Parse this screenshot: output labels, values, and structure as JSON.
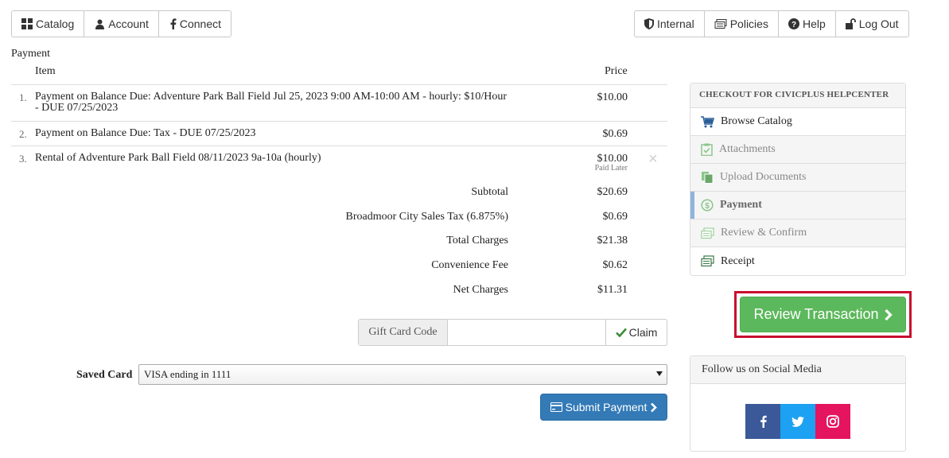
{
  "nav_left": [
    {
      "label": "Catalog",
      "icon": "grid-icon"
    },
    {
      "label": "Account",
      "icon": "user-icon"
    },
    {
      "label": "Connect",
      "icon": "facebook-icon"
    }
  ],
  "nav_right": [
    {
      "label": "Internal",
      "icon": "shield-icon"
    },
    {
      "label": "Policies",
      "icon": "money-icon"
    },
    {
      "label": "Help",
      "icon": "question-icon"
    },
    {
      "label": "Log Out",
      "icon": "unlock-icon"
    }
  ],
  "payment": {
    "section_label": "Payment",
    "col_item": "Item",
    "col_price": "Price",
    "rows": [
      {
        "num": "1.",
        "desc": "Payment on Balance Due: Adventure Park Ball Field Jul 25, 2023 9:00 AM-10:00 AM - hourly: $10/Hour - DUE 07/25/2023",
        "price": "$10.00"
      },
      {
        "num": "2.",
        "desc": "Payment on Balance Due: Tax - DUE 07/25/2023",
        "price": "$0.69"
      },
      {
        "num": "3.",
        "desc": "Rental of Adventure Park Ball Field 08/11/2023 9a-10a (hourly)",
        "price": "$10.00",
        "note": "Paid Later",
        "remove": "×"
      }
    ],
    "totals": [
      {
        "label": "Subtotal",
        "value": "$20.69"
      },
      {
        "label": "Broadmoor City Sales Tax (6.875%)",
        "value": "$0.69"
      },
      {
        "label": "Total Charges",
        "value": "$21.38"
      },
      {
        "label": "Convenience Fee",
        "value": "$0.62"
      },
      {
        "label": "Net Charges",
        "value": "$11.31"
      }
    ]
  },
  "gift_card": {
    "label": "Gift Card Code",
    "value": "",
    "claim_label": "Claim"
  },
  "saved_card": {
    "label": "Saved Card",
    "selected": "VISA ending in 1111"
  },
  "submit_label": "Submit Payment",
  "checkout": {
    "title": "CHECKOUT FOR CIVICPLUS HELPCENTER",
    "steps": [
      {
        "label": "Browse Catalog",
        "icon": "cart-icon",
        "state": "normal"
      },
      {
        "label": "Attachments",
        "icon": "clipboard-check-icon",
        "state": "dim"
      },
      {
        "label": "Upload Documents",
        "icon": "documents-icon",
        "state": "dim"
      },
      {
        "label": "Payment",
        "icon": "dollar-circle-icon",
        "state": "active"
      },
      {
        "label": "Review & Confirm",
        "icon": "money-icon",
        "state": "dim"
      },
      {
        "label": "Receipt",
        "icon": "money-icon",
        "state": "normal"
      }
    ]
  },
  "review_label": "Review Transaction",
  "social": {
    "title": "Follow us on Social Media",
    "links": [
      {
        "name": "facebook",
        "color": "#3b5998"
      },
      {
        "name": "twitter",
        "color": "#1da1f2"
      },
      {
        "name": "instagram",
        "color": "#e4145e"
      }
    ]
  },
  "colors": {
    "primary": "#337ab7",
    "success": "#5cb85c",
    "highlight": "#c8102e"
  }
}
